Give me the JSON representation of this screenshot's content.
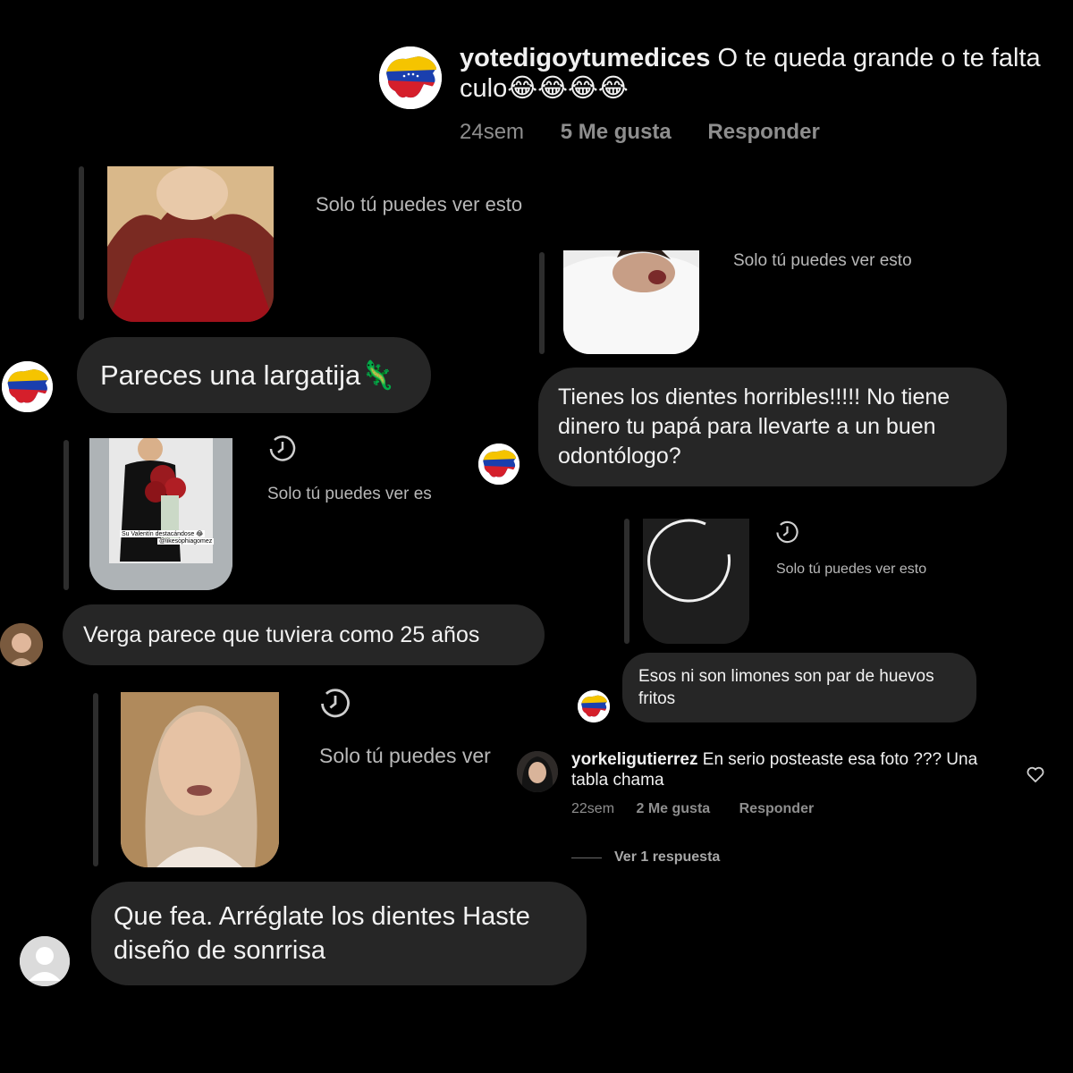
{
  "top_comment": {
    "username": "yotedigoytumedices",
    "text": "O te queda grande o te falta culo😂😂😂😂",
    "time": "24sem",
    "likes": "5 Me gusta",
    "reply": "Responder"
  },
  "story_label": "Solo tú puedes ver esto",
  "reply_1": {
    "text": "Pareces una largatija🦎",
    "only_you": "Solo tú puedes ver esto"
  },
  "reply_2": {
    "text": "Tienes los dientes  horribles!!!!! No tiene dinero tu papá para llevarte a un buen odontólogo?",
    "only_you": "Solo tú puedes ver esto"
  },
  "reply_3": {
    "text": "Verga parece que tuviera como 25 años",
    "only_you": "Solo tú puedes ver es",
    "story_caption_1": "Su Valentín destacándose 😂",
    "story_caption_2": "@likesophiagomez"
  },
  "reply_4": {
    "text": "Esos ni son limones son par de huevos fritos",
    "only_you": "Solo tú puedes ver esto"
  },
  "reply_5": {
    "text": "Que fea. Arréglate los dientes Haste diseño de sonrrisa",
    "only_you": "Solo tú puedes ver"
  },
  "comment_2": {
    "username": "yorkeligutierrez",
    "text": "En serio posteaste esa foto ??? Una tabla chama",
    "time": "22sem",
    "likes": "2 Me gusta",
    "reply": "Responder",
    "view_replies": "Ver 1 respuesta"
  },
  "colors": {
    "background": "#000000",
    "bubble": "#262626",
    "meta_text": "#8e8e8e",
    "flag_yellow": "#f5c400",
    "flag_blue": "#1a3fae",
    "flag_red": "#d51f2b"
  },
  "icons": [
    "venezuela-map-avatar",
    "history-icon",
    "heart-icon",
    "default-avatar-icon"
  ]
}
